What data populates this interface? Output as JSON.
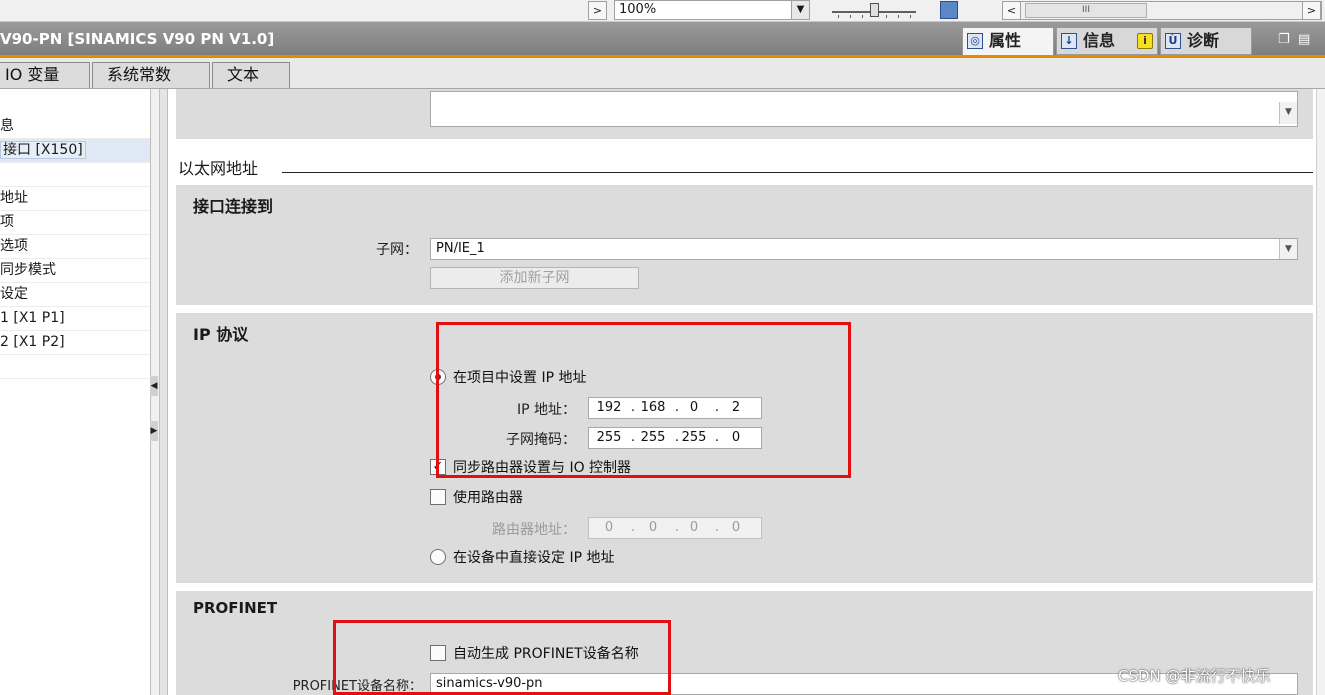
{
  "toolbar": {
    "zoom_value": "100%",
    "scroll_thumb": "III",
    "prev_arrow": ">",
    "scroll_left_arrow": "<",
    "scroll_right_arrow": ">",
    "dropdown_glyph": "▼"
  },
  "titlebar": {
    "title": "V90-PN [SINAMICS V90 PN V1.0]",
    "tabs": [
      {
        "label": "属性",
        "icon": "properties-icon"
      },
      {
        "label": "信息",
        "icon": "info-icon",
        "badge": "i"
      },
      {
        "label": "诊断",
        "icon": "diagnostics-icon"
      }
    ]
  },
  "tabs": [
    "IO 变量",
    "系统常数",
    "文本"
  ],
  "leftnav": {
    "items": [
      "息",
      "接口 [X150]",
      "",
      "地址",
      "项",
      "选项",
      "同步模式",
      "设定",
      "1 [X1 P1]",
      "2 [X1 P2]",
      ""
    ],
    "selected_index": 1
  },
  "ethernet": {
    "heading": "以太网地址",
    "interface_section": {
      "title": "接口连接到",
      "subnet_label": "子网：",
      "subnet_value": "PN/IE_1",
      "add_subnet_button": "添加新子网"
    },
    "ip_section": {
      "title": "IP 协议",
      "radio_set_in_project": "在项目中设置 IP 地址",
      "ip_label": "IP 地址：",
      "ip_octets": [
        "192",
        "168",
        "0",
        "2"
      ],
      "mask_label": "子网掩码：",
      "mask_octets": [
        "255",
        "255",
        "255",
        "0"
      ],
      "sync_router_label": "同步路由器设置与 IO 控制器",
      "sync_router_checked": true,
      "use_router_label": "使用路由器",
      "use_router_checked": false,
      "router_addr_label": "路由器地址：",
      "router_octets": [
        "0",
        "0",
        "0",
        "0"
      ],
      "radio_set_on_device": "在设备中直接设定 IP 地址"
    },
    "profinet_section": {
      "title": "PROFINET",
      "auto_name_label": "自动生成 PROFINET设备名称",
      "auto_name_checked": false,
      "device_name_label": "PROFINET设备名称：",
      "device_name_value": "sinamics-v90-pn"
    }
  },
  "watermark": "CSDN @非流行不快乐",
  "colors": {
    "accent_orange": "#e68a00",
    "highlight_red": "#e01010",
    "section_bg": "#dcdcdc"
  }
}
